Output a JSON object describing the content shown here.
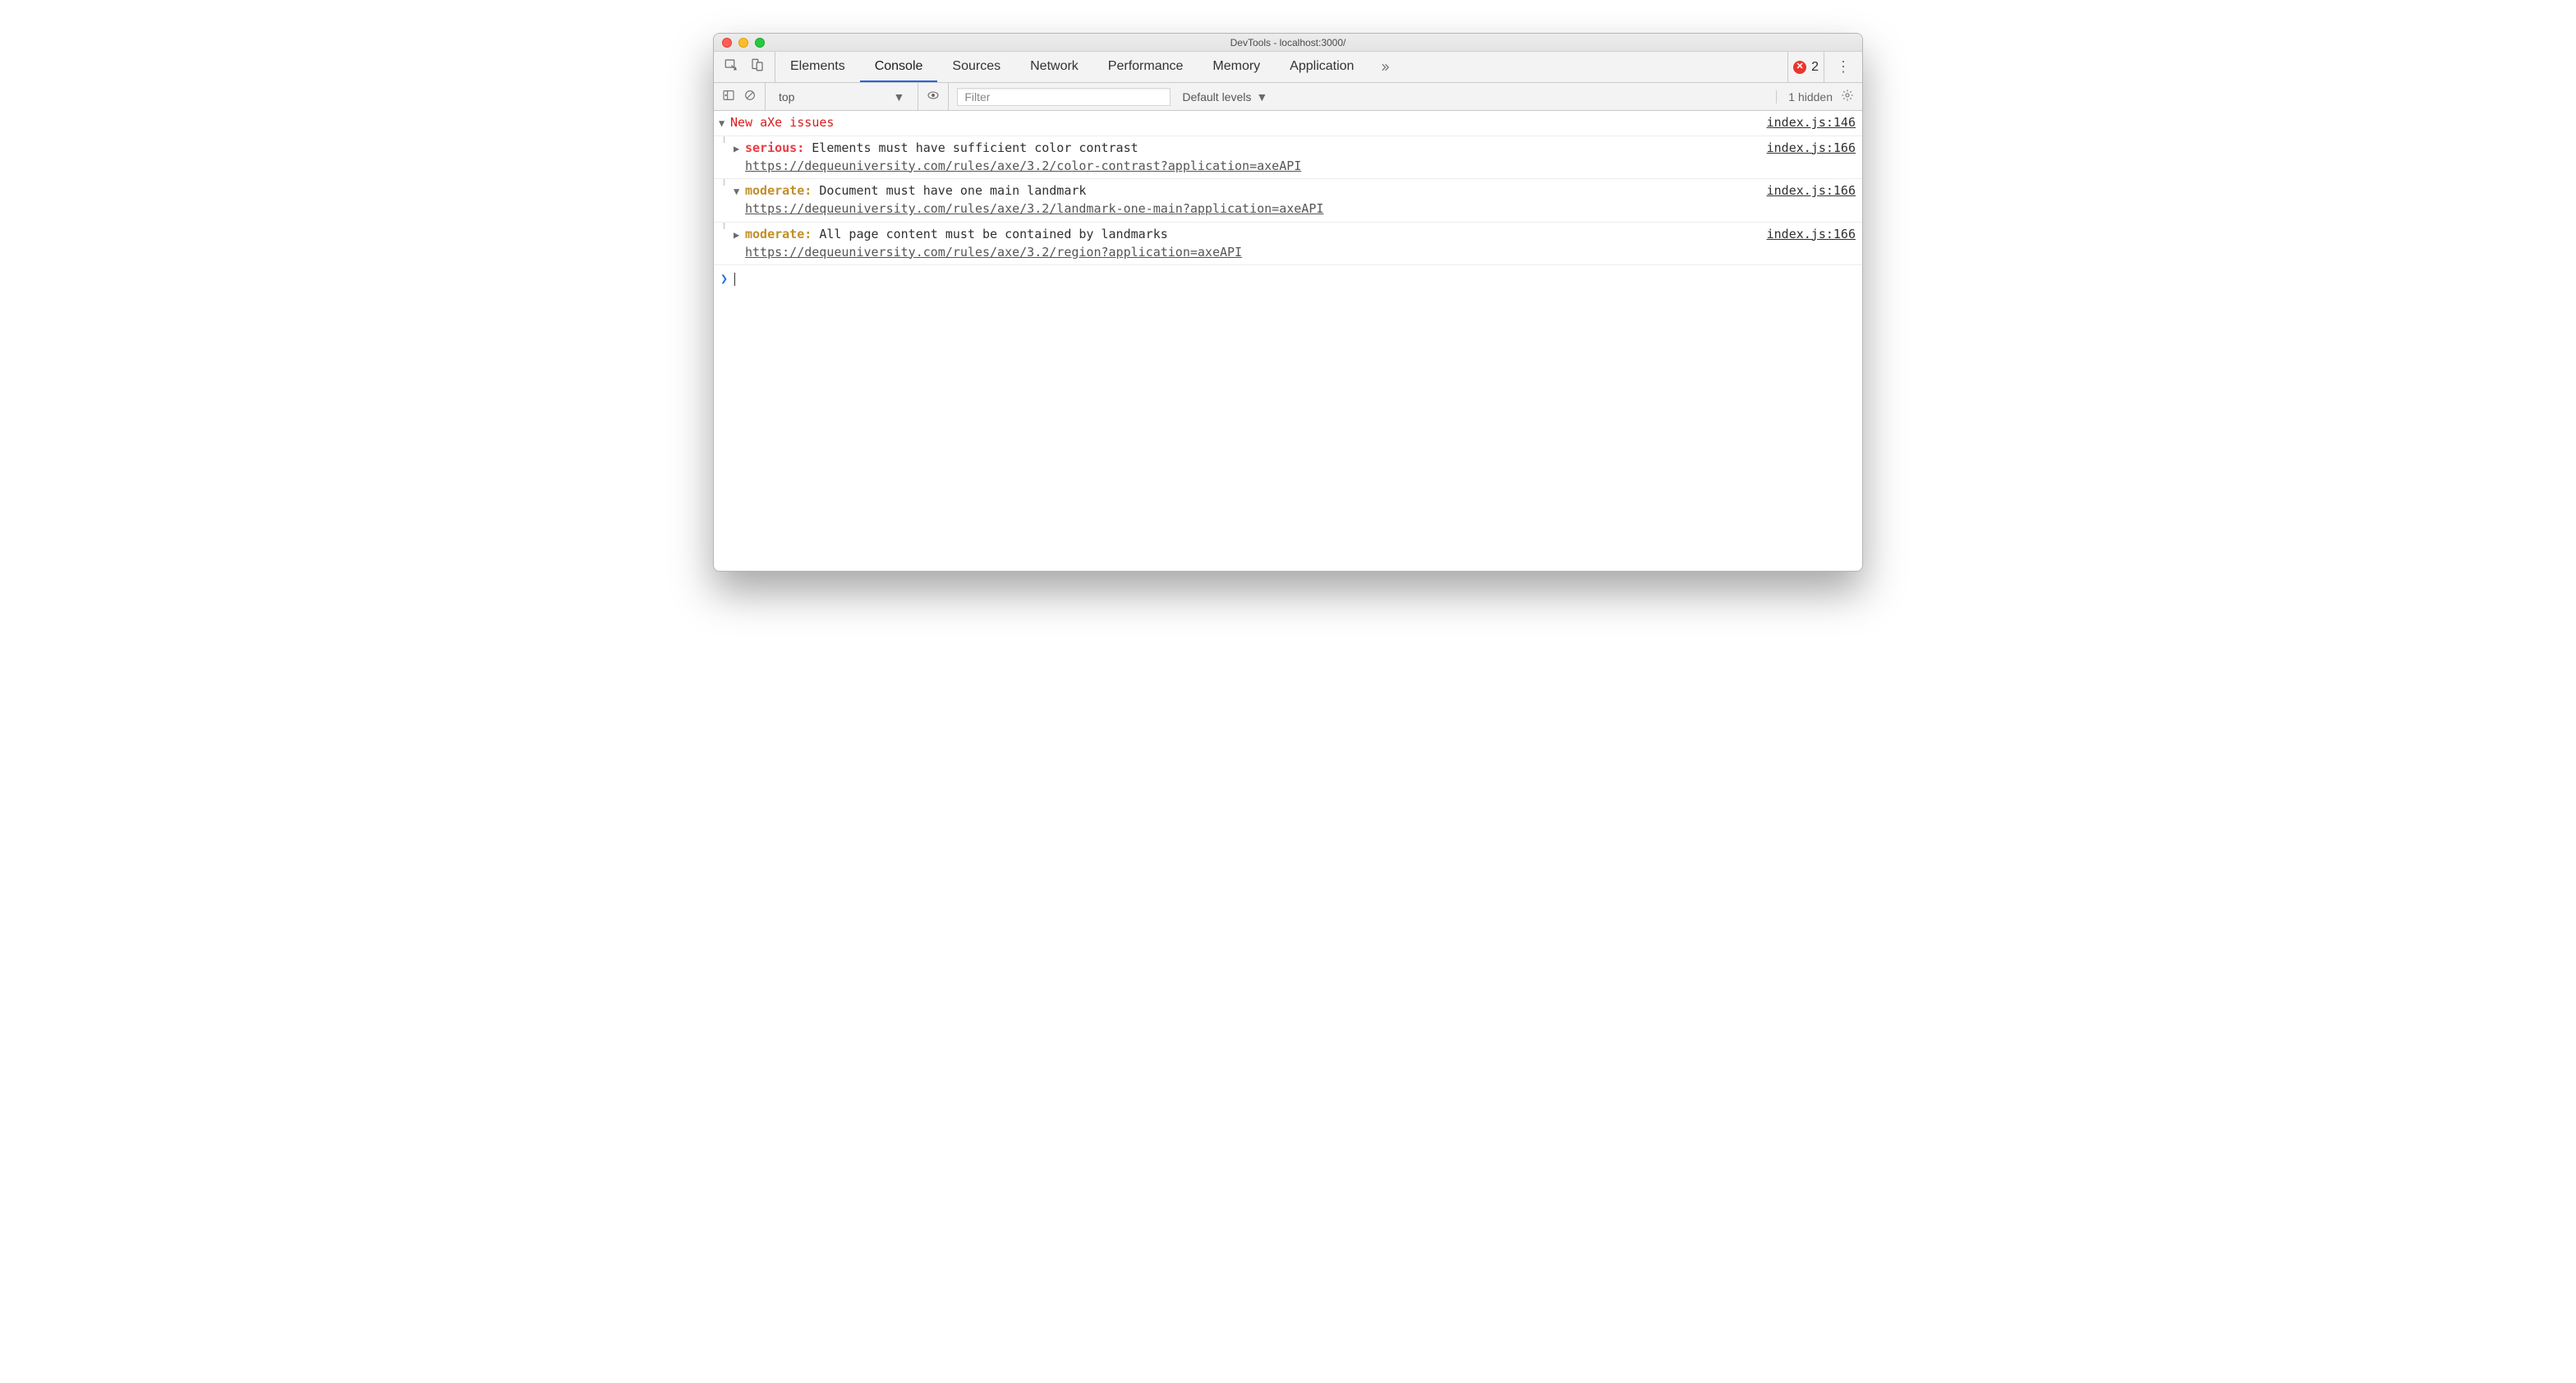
{
  "window": {
    "title": "DevTools - localhost:3000/"
  },
  "tabs": {
    "items": [
      "Elements",
      "Console",
      "Sources",
      "Network",
      "Performance",
      "Memory",
      "Application"
    ],
    "activeIndex": 1
  },
  "errorBadge": {
    "count": "2"
  },
  "consoleBar": {
    "context": "top",
    "filterPlaceholder": "Filter",
    "levels": "Default levels",
    "hidden": "1 hidden"
  },
  "log": {
    "group": {
      "title": "New aXe issues",
      "source": "index.js:146"
    },
    "entries": [
      {
        "expanded": false,
        "severity": "serious",
        "severityLabel": "serious:",
        "message": "Elements must have sufficient color contrast",
        "url": "https://dequeuniversity.com/rules/axe/3.2/color-contrast?application=axeAPI",
        "source": "index.js:166"
      },
      {
        "expanded": true,
        "severity": "moderate",
        "severityLabel": "moderate:",
        "message": "Document must have one main landmark",
        "url": "https://dequeuniversity.com/rules/axe/3.2/landmark-one-main?application=axeAPI",
        "source": "index.js:166"
      },
      {
        "expanded": false,
        "severity": "moderate",
        "severityLabel": "moderate:",
        "message": "All page content must be contained by landmarks",
        "url": "https://dequeuniversity.com/rules/axe/3.2/region?application=axeAPI",
        "source": "index.js:166"
      }
    ]
  }
}
